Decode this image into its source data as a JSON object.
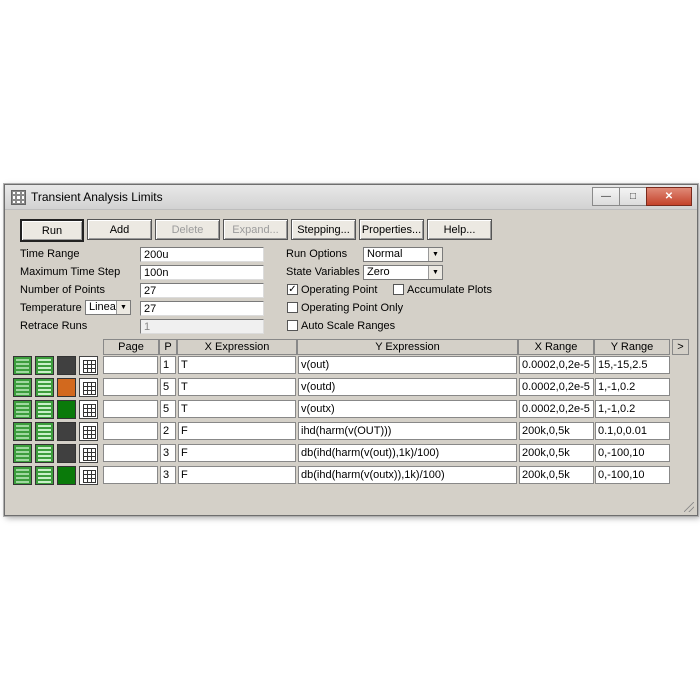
{
  "window": {
    "title": "Transient Analysis Limits"
  },
  "toolbar": {
    "run": "Run",
    "add": "Add",
    "delete": "Delete",
    "expand": "Expand...",
    "stepping": "Stepping...",
    "properties": "Properties...",
    "help": "Help..."
  },
  "params": {
    "time_range_label": "Time Range",
    "time_range": "200u",
    "max_step_label": "Maximum Time Step",
    "max_step": "100n",
    "num_points_label": "Number of Points",
    "num_points": "27",
    "temperature_label": "Temperature",
    "temperature_mode": "Linear",
    "temperature": "27",
    "retrace_label": "Retrace Runs",
    "retrace": "1"
  },
  "options": {
    "run_options_label": "Run Options",
    "run_options": "Normal",
    "state_vars_label": "State Variables",
    "state_vars": "Zero",
    "operating_point": "Operating Point",
    "operating_point_checked": true,
    "accumulate": "Accumulate Plots",
    "accumulate_checked": false,
    "op_only": "Operating Point Only",
    "op_only_checked": false,
    "auto_scale": "Auto Scale Ranges",
    "auto_scale_checked": false
  },
  "grid": {
    "headers": {
      "page": "Page",
      "p": "P",
      "x_expr": "X Expression",
      "y_expr": "Y Expression",
      "x_range": "X Range",
      "y_range": "Y Range",
      "more": ">"
    },
    "rows": [
      {
        "color": "#404040",
        "page": "",
        "p": "1",
        "x": "T",
        "y_pre": "v",
        "y_mid": "(out)",
        "y_post": "",
        "xr": "0.0002,0,2e-5",
        "yr": "15,-15,2.5"
      },
      {
        "color": "#d2691e",
        "page": "",
        "p": "5",
        "x": "T",
        "y_pre": "v",
        "y_mid": "(outd)",
        "y_post": "",
        "xr": "0.0002,0,2e-5",
        "yr": "1,-1,0.2"
      },
      {
        "color": "#0a7a0a",
        "page": "",
        "p": "5",
        "x": "T",
        "y_pre": "v",
        "y_mid": "(outx)",
        "y_post": "",
        "xr": "0.0002,0,2e-5",
        "yr": "1,-1,0.2"
      },
      {
        "color": "#404040",
        "page": "",
        "p": "2",
        "x": "F",
        "y_pre": "ihd(harm(v(OUT)))",
        "y_mid": "",
        "y_post": "",
        "xr": "200k,0,5k",
        "yr": "0.1,0,0.01"
      },
      {
        "color": "#404040",
        "page": "",
        "p": "3",
        "x": "F",
        "y_pre": "db(ihd(harm(v(out)),1k)/100)",
        "y_mid": "",
        "y_post": "",
        "xr": "200k,0,5k",
        "yr": "0,-100,10"
      },
      {
        "color": "#0a7a0a",
        "page": "",
        "p": "3",
        "x": "F",
        "y_pre": "db(ihd(harm(v(outx)),1k)/100)",
        "y_mid": "",
        "y_post": "",
        "xr": "200k,0,5k",
        "yr": "0,-100,10"
      }
    ]
  }
}
